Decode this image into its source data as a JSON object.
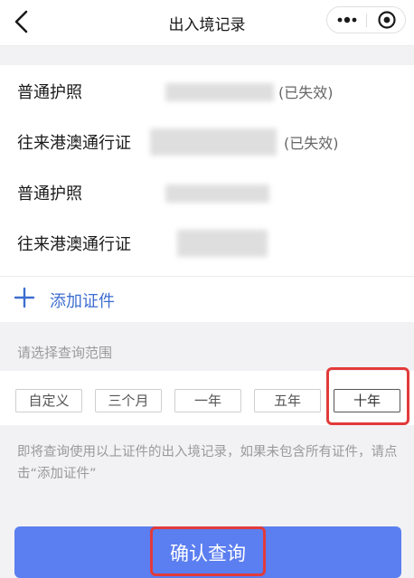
{
  "nav": {
    "title": "出入境记录"
  },
  "documents": [
    {
      "name": "普通护照",
      "status": "(已失效)"
    },
    {
      "name": "往来港澳通行证",
      "status": "(已失效)"
    },
    {
      "name": "普通护照",
      "status": ""
    },
    {
      "name": "往来港澳通行证",
      "status": ""
    }
  ],
  "add_document": {
    "label": "添加证件"
  },
  "range": {
    "label": "请选择查询范围",
    "options": [
      "自定义",
      "三个月",
      "一年",
      "五年",
      "十年"
    ],
    "selected": "十年"
  },
  "note": "即将查询使用以上证件的出入境记录，如果未包含所有证件，请点击“添加证件”",
  "confirm": {
    "label": "确认查询"
  },
  "colors": {
    "accent": "#5b7ef0",
    "link": "#3d6ed0",
    "highlight": "#e23b3b"
  }
}
